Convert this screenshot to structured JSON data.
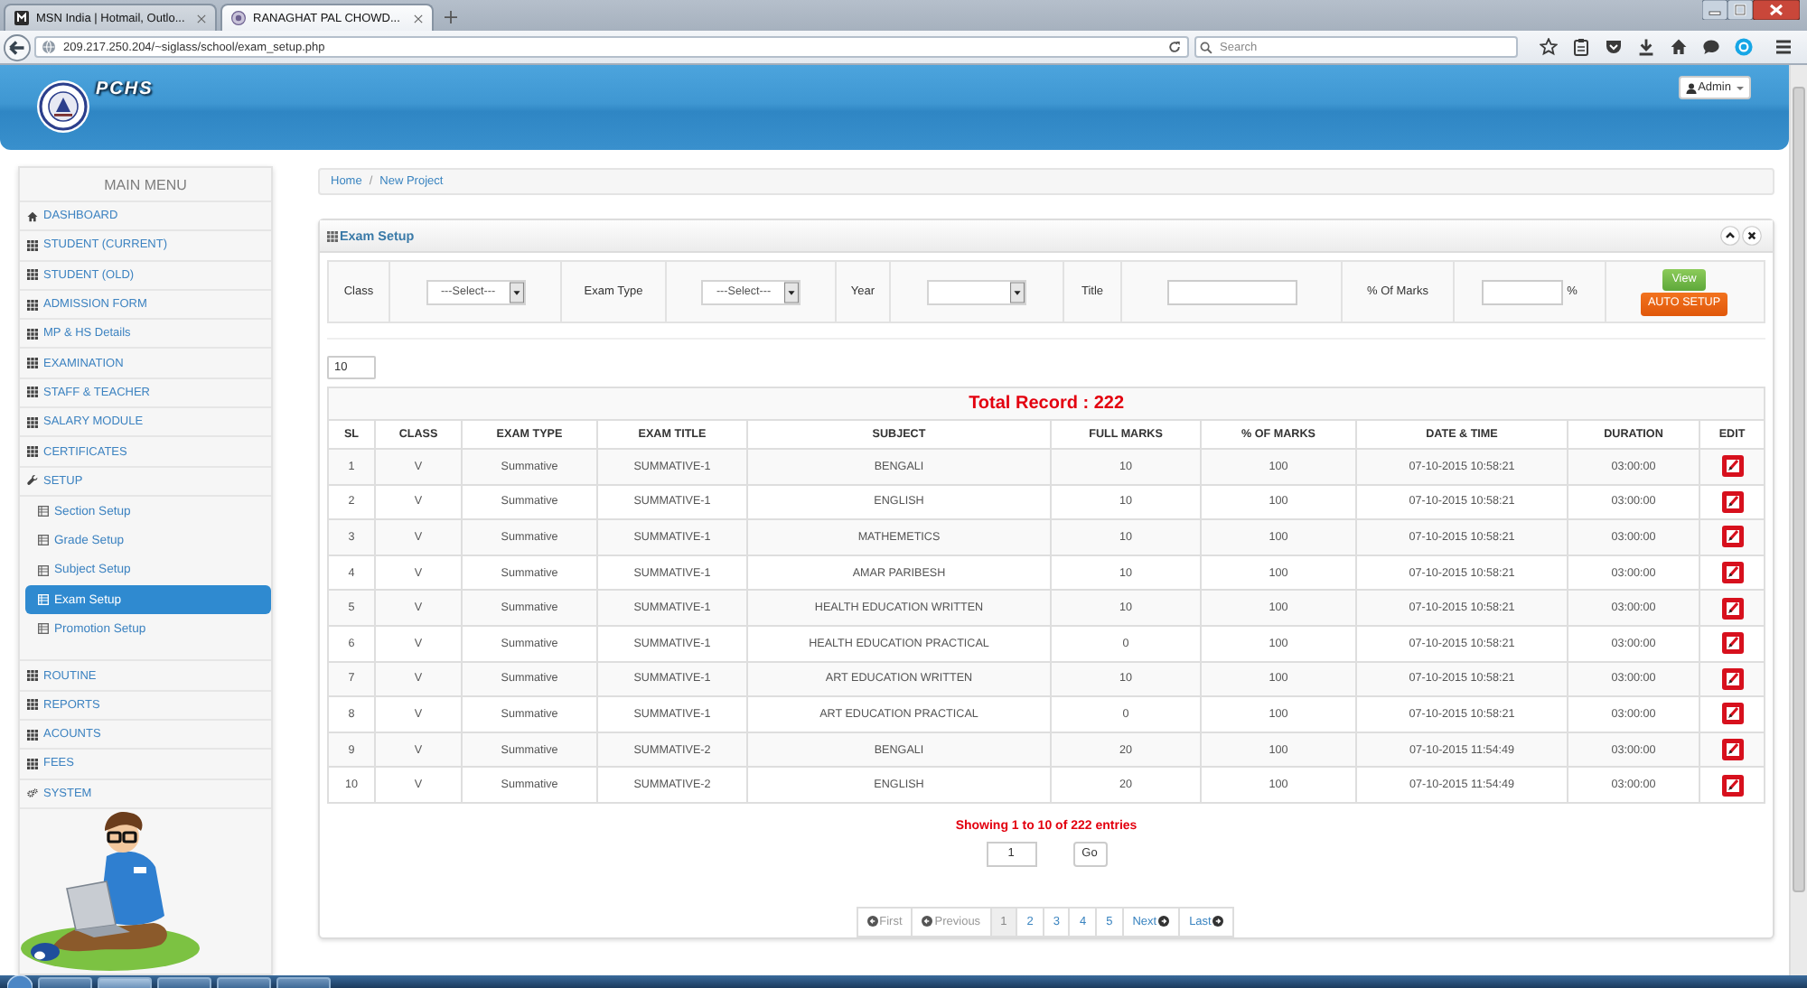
{
  "browser": {
    "tabs": [
      {
        "title": "MSN India | Hotmail, Outlo...",
        "selected": false
      },
      {
        "title": "RANAGHAT PAL CHOWD...",
        "selected": true
      }
    ],
    "url": "209.217.250.204/~siglass/school/exam_setup.php",
    "search": {
      "placeholder": "Search"
    }
  },
  "header": {
    "brand": "PCHS",
    "user_menu": "Admin"
  },
  "sidebar": {
    "title": "MAIN MENU",
    "items": [
      {
        "label": "DASHBOARD",
        "selected": false
      },
      {
        "label": "STUDENT (CURRENT)",
        "selected": false
      },
      {
        "label": "STUDENT (OLD)",
        "selected": false
      },
      {
        "label": "ADMISSION FORM",
        "selected": false
      },
      {
        "label": "MP & HS Details",
        "selected": false
      },
      {
        "label": "EXAMINATION",
        "selected": false
      },
      {
        "label": "STAFF & TEACHER",
        "selected": false
      },
      {
        "label": "SALARY MODULE",
        "selected": false
      },
      {
        "label": "CERTIFICATES",
        "selected": false
      },
      {
        "label": "SETUP",
        "selected": false,
        "children": [
          {
            "label": "Section Setup",
            "selected": false
          },
          {
            "label": "Grade Setup",
            "selected": false
          },
          {
            "label": "Subject Setup",
            "selected": false
          },
          {
            "label": "Exam Setup",
            "selected": true
          },
          {
            "label": "Promotion Setup",
            "selected": false
          }
        ]
      },
      {
        "label": "ROUTINE",
        "selected": false
      },
      {
        "label": "REPORTS",
        "selected": false
      },
      {
        "label": "ACOUNTS",
        "selected": false
      },
      {
        "label": "FEES",
        "selected": false
      },
      {
        "label": "SYSTEM",
        "selected": false
      }
    ]
  },
  "breadcrumb": {
    "items": [
      "Home",
      "New Project"
    ],
    "separator": "/"
  },
  "panel": {
    "title": "Exam Setup",
    "filters": [
      {
        "label": "Class",
        "kind": "select",
        "value": "---Select---"
      },
      {
        "label": "Exam Type",
        "kind": "select",
        "value": "---Select---"
      },
      {
        "label": "Year",
        "kind": "select"
      },
      {
        "label": "Title",
        "kind": "input"
      },
      {
        "label": "% Of Marks",
        "kind": "input",
        "suffix": "%"
      }
    ],
    "buttons": [
      {
        "label": "View",
        "kind": "view"
      },
      {
        "label": "AUTO SETUP",
        "kind": "auto"
      }
    ],
    "page_length": "10",
    "table": {
      "caption": "Total Record : 222",
      "columns": [
        "SL",
        "CLASS",
        "EXAM TYPE",
        "EXAM TITLE",
        "SUBJECT",
        "FULL MARKS",
        "% OF MARKS",
        "DATE & TIME",
        "DURATION",
        "EDIT"
      ],
      "rows": [
        [
          "1",
          "V",
          "Summative",
          "SUMMATIVE-1",
          "BENGALI",
          "10",
          "100",
          "07-10-2015 10:58:21",
          "03:00:00"
        ],
        [
          "2",
          "V",
          "Summative",
          "SUMMATIVE-1",
          "ENGLISH",
          "10",
          "100",
          "07-10-2015 10:58:21",
          "03:00:00"
        ],
        [
          "3",
          "V",
          "Summative",
          "SUMMATIVE-1",
          "MATHEMETICS",
          "10",
          "100",
          "07-10-2015 10:58:21",
          "03:00:00"
        ],
        [
          "4",
          "V",
          "Summative",
          "SUMMATIVE-1",
          "AMAR PARIBESH",
          "10",
          "100",
          "07-10-2015 10:58:21",
          "03:00:00"
        ],
        [
          "5",
          "V",
          "Summative",
          "SUMMATIVE-1",
          "HEALTH EDUCATION WRITTEN",
          "10",
          "100",
          "07-10-2015 10:58:21",
          "03:00:00"
        ],
        [
          "6",
          "V",
          "Summative",
          "SUMMATIVE-1",
          "HEALTH EDUCATION PRACTICAL",
          "0",
          "100",
          "07-10-2015 10:58:21",
          "03:00:00"
        ],
        [
          "7",
          "V",
          "Summative",
          "SUMMATIVE-1",
          "ART EDUCATION WRITTEN",
          "10",
          "100",
          "07-10-2015 10:58:21",
          "03:00:00"
        ],
        [
          "8",
          "V",
          "Summative",
          "SUMMATIVE-1",
          "ART EDUCATION PRACTICAL",
          "0",
          "100",
          "07-10-2015 10:58:21",
          "03:00:00"
        ],
        [
          "9",
          "V",
          "Summative",
          "SUMMATIVE-2",
          "BENGALI",
          "20",
          "100",
          "07-10-2015 11:54:49",
          "03:00:00"
        ],
        [
          "10",
          "V",
          "Summative",
          "SUMMATIVE-2",
          "ENGLISH",
          "20",
          "100",
          "07-10-2015 11:54:49",
          "03:00:00"
        ]
      ]
    },
    "summary": "Showing 1 to 10 of 222 entries",
    "goto": {
      "value": "1",
      "button": "Go"
    },
    "pagination": {
      "first": {
        "label": "First",
        "disabled": true
      },
      "previous": {
        "label": "Previous",
        "disabled": true
      },
      "pages": [
        {
          "label": "1",
          "selected": true
        },
        {
          "label": "2",
          "selected": false
        },
        {
          "label": "3",
          "selected": false
        },
        {
          "label": "4",
          "selected": false
        },
        {
          "label": "5",
          "selected": false
        }
      ],
      "next": {
        "label": "Next",
        "disabled": false
      },
      "last": {
        "label": "Last",
        "disabled": false
      }
    }
  }
}
